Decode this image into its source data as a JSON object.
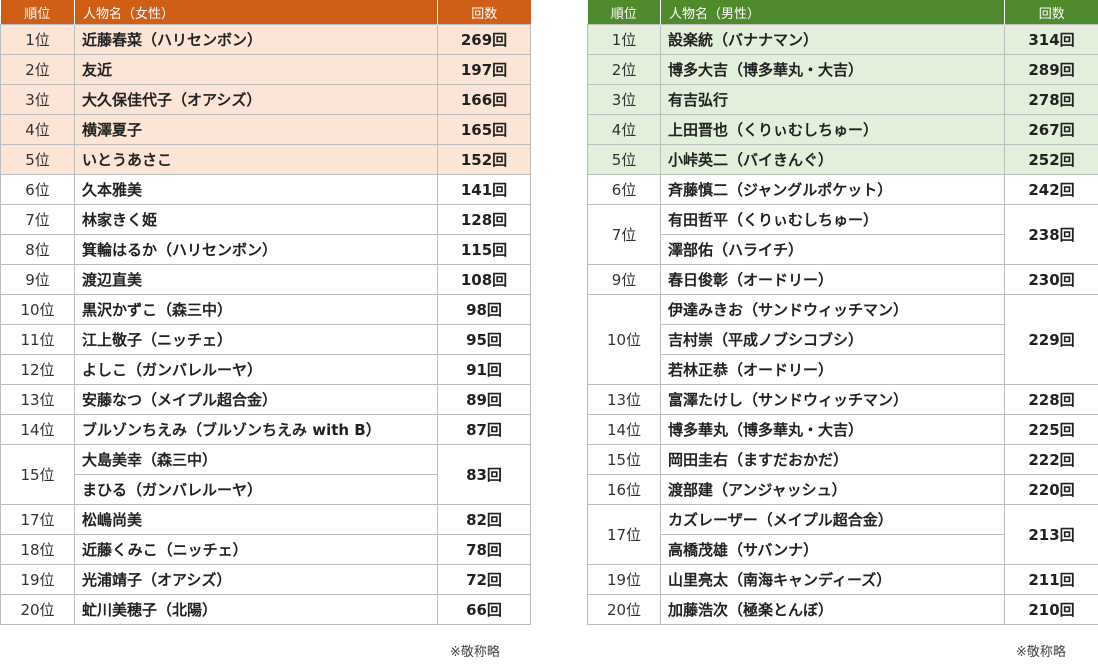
{
  "female": {
    "headers": {
      "rank": "順位",
      "name": "人物名（女性）",
      "count": "回数"
    },
    "rows": [
      {
        "rank": "1位",
        "names": [
          "近藤春菜（ハリセンボン）"
        ],
        "count": "269回",
        "top": true
      },
      {
        "rank": "2位",
        "names": [
          "友近"
        ],
        "count": "197回",
        "top": true
      },
      {
        "rank": "3位",
        "names": [
          "大久保佳代子（オアシズ）"
        ],
        "count": "166回",
        "top": true
      },
      {
        "rank": "4位",
        "names": [
          "横澤夏子"
        ],
        "count": "165回",
        "top": true
      },
      {
        "rank": "5位",
        "names": [
          "いとうあさこ"
        ],
        "count": "152回",
        "top": true
      },
      {
        "rank": "6位",
        "names": [
          "久本雅美"
        ],
        "count": "141回"
      },
      {
        "rank": "7位",
        "names": [
          "林家きく姫"
        ],
        "count": "128回"
      },
      {
        "rank": "8位",
        "names": [
          "箕輪はるか（ハリセンボン）"
        ],
        "count": "115回"
      },
      {
        "rank": "9位",
        "names": [
          "渡辺直美"
        ],
        "count": "108回"
      },
      {
        "rank": "10位",
        "names": [
          "黒沢かずこ（森三中）"
        ],
        "count": "98回"
      },
      {
        "rank": "11位",
        "names": [
          "江上敬子（ニッチェ）"
        ],
        "count": "95回"
      },
      {
        "rank": "12位",
        "names": [
          "よしこ（ガンバレルーヤ）"
        ],
        "count": "91回"
      },
      {
        "rank": "13位",
        "names": [
          "安藤なつ（メイプル超合金）"
        ],
        "count": "89回"
      },
      {
        "rank": "14位",
        "names": [
          "ブルゾンちえみ（ブルゾンちえみ with B）"
        ],
        "count": "87回"
      },
      {
        "rank": "15位",
        "names": [
          "大島美幸（森三中）",
          "まひる（ガンバレルーヤ）"
        ],
        "count": "83回"
      },
      {
        "rank": "17位",
        "names": [
          "松嶋尚美"
        ],
        "count": "82回"
      },
      {
        "rank": "18位",
        "names": [
          "近藤くみこ（ニッチェ）"
        ],
        "count": "78回"
      },
      {
        "rank": "19位",
        "names": [
          "光浦靖子（オアシズ）"
        ],
        "count": "72回"
      },
      {
        "rank": "20位",
        "names": [
          "虻川美穂子（北陽）"
        ],
        "count": "66回"
      }
    ],
    "note": "※敬称略"
  },
  "male": {
    "headers": {
      "rank": "順位",
      "name": "人物名（男性）",
      "count": "回数"
    },
    "rows": [
      {
        "rank": "1位",
        "names": [
          "設楽統（バナナマン）"
        ],
        "count": "314回",
        "top": true
      },
      {
        "rank": "2位",
        "names": [
          "博多大吉（博多華丸・大吉）"
        ],
        "count": "289回",
        "top": true
      },
      {
        "rank": "3位",
        "names": [
          "有吉弘行"
        ],
        "count": "278回",
        "top": true
      },
      {
        "rank": "4位",
        "names": [
          "上田晋也（くりぃむしちゅー）"
        ],
        "count": "267回",
        "top": true
      },
      {
        "rank": "5位",
        "names": [
          "小峠英二（バイきんぐ）"
        ],
        "count": "252回",
        "top": true
      },
      {
        "rank": "6位",
        "names": [
          "斉藤慎二（ジャングルポケット）"
        ],
        "count": "242回"
      },
      {
        "rank": "7位",
        "names": [
          "有田哲平（くりぃむしちゅー）",
          "澤部佑（ハライチ）"
        ],
        "count": "238回"
      },
      {
        "rank": "9位",
        "names": [
          "春日俊彰（オードリー）"
        ],
        "count": "230回"
      },
      {
        "rank": "10位",
        "names": [
          "伊達みきお（サンドウィッチマン）",
          "吉村崇（平成ノブシコブシ）",
          "若林正恭（オードリー）"
        ],
        "count": "229回"
      },
      {
        "rank": "13位",
        "names": [
          "富澤たけし（サンドウィッチマン）"
        ],
        "count": "228回"
      },
      {
        "rank": "14位",
        "names": [
          "博多華丸（博多華丸・大吉）"
        ],
        "count": "225回"
      },
      {
        "rank": "15位",
        "names": [
          "岡田圭右（ますだおかだ）"
        ],
        "count": "222回"
      },
      {
        "rank": "16位",
        "names": [
          "渡部建（アンジャッシュ）"
        ],
        "count": "220回"
      },
      {
        "rank": "17位",
        "names": [
          "カズレーザー（メイプル超合金）",
          "高橋茂雄（サバンナ）"
        ],
        "count": "213回"
      },
      {
        "rank": "19位",
        "names": [
          "山里亮太（南海キャンディーズ）"
        ],
        "count": "211回"
      },
      {
        "rank": "20位",
        "names": [
          "加藤浩次（極楽とんぼ）"
        ],
        "count": "210回"
      }
    ],
    "note": "※敬称略"
  }
}
